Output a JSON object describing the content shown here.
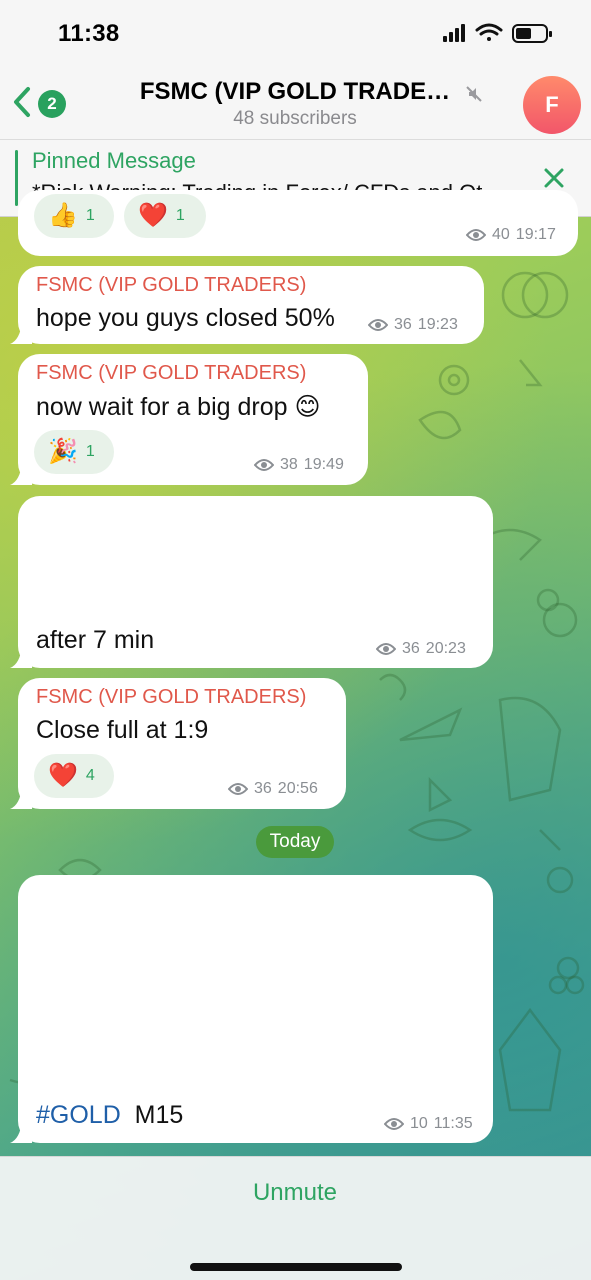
{
  "status_bar": {
    "time": "11:38"
  },
  "header": {
    "back_count": "2",
    "title": "FSMC (VIP GOLD TRADE…",
    "subtitle": "48 subscribers",
    "avatar_letter": "F"
  },
  "pinned": {
    "label": "Pinned Message",
    "text": "*Risk Warning: Trading in Forex/ CFDs and Ot…"
  },
  "messages": [
    {
      "reactions": [
        {
          "emoji": "👍",
          "count": "1"
        },
        {
          "emoji": "❤️",
          "count": "1"
        }
      ],
      "views": "40",
      "time": "19:17"
    },
    {
      "sender": "FSMC (VIP GOLD TRADERS)",
      "text": "hope you guys closed 50%",
      "views": "36",
      "time": "19:23"
    },
    {
      "sender": "FSMC (VIP GOLD TRADERS)",
      "text": "now wait for a big drop 😊",
      "reactions": [
        {
          "emoji": "🎉",
          "count": "1"
        }
      ],
      "views": "38",
      "time": "19:49"
    },
    {
      "text": "after 7 min",
      "views": "36",
      "time": "20:23"
    },
    {
      "sender": "FSMC (VIP GOLD TRADERS)",
      "text": "Close full at 1:9",
      "reactions": [
        {
          "emoji": "❤️",
          "count": "4"
        }
      ],
      "views": "36",
      "time": "20:56"
    },
    {
      "hashtag": "#GOLD",
      "text": "M15",
      "views": "10",
      "time": "11:35"
    }
  ],
  "date_separator": "Today",
  "bottom": {
    "action_label": "Unmute"
  },
  "colors": {
    "accent_green": "#2ea462",
    "sender_red": "#e0584b",
    "hashtag_blue": "#1f5fa8",
    "date_chip": "#4a9a3c"
  },
  "icons": [
    "back-chevron-icon",
    "mute-icon",
    "close-icon",
    "eye-icon",
    "signal-icon",
    "wifi-icon",
    "battery-icon"
  ]
}
